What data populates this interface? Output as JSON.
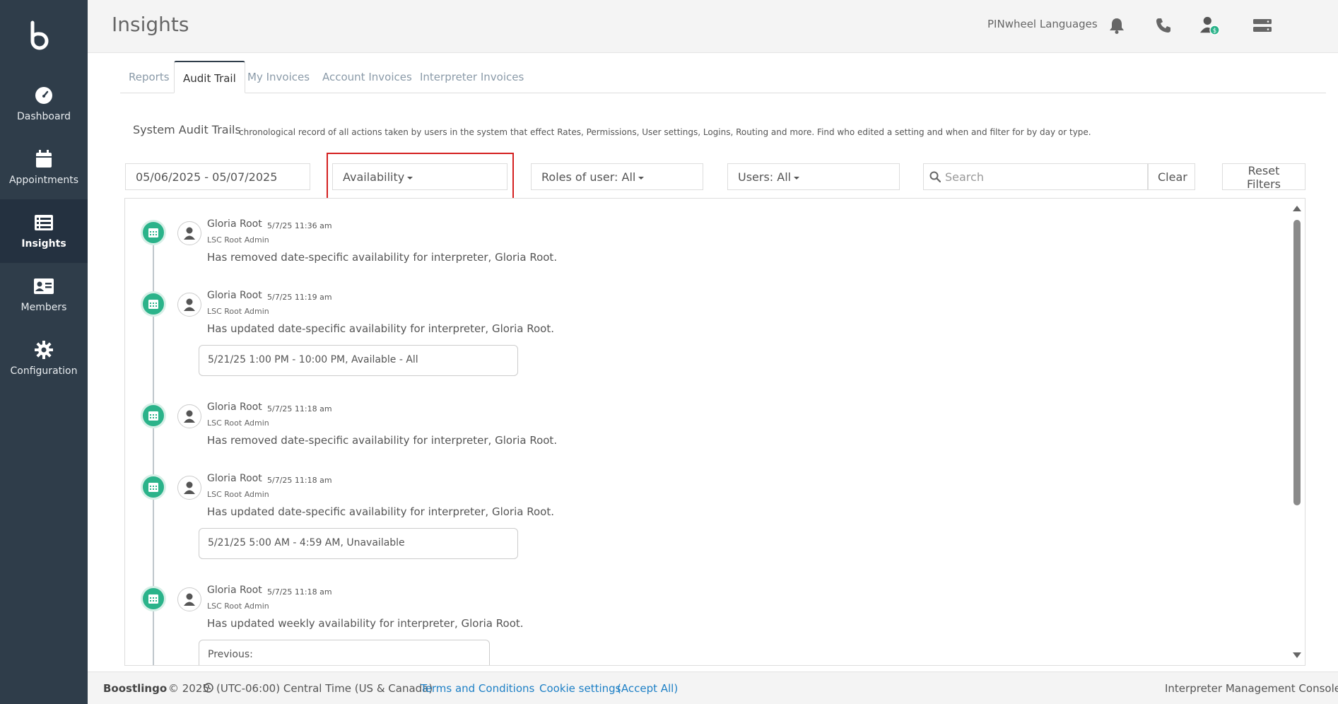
{
  "app": {
    "page_title": "Insights",
    "org_name": "PINwheel Languages"
  },
  "sidebar": {
    "items": [
      {
        "label": "Dashboard",
        "icon": "dashboard-icon"
      },
      {
        "label": "Appointments",
        "icon": "calendar-icon"
      },
      {
        "label": "Insights",
        "icon": "list-icon",
        "active": true
      },
      {
        "label": "Members",
        "icon": "id-card-icon"
      },
      {
        "label": "Configuration",
        "icon": "gear-icon"
      }
    ]
  },
  "header_icons": [
    "bell-icon",
    "phone-icon",
    "user-status-icon",
    "server-icon"
  ],
  "tabs": [
    {
      "label": "Reports"
    },
    {
      "label": "Audit Trail",
      "active": true
    },
    {
      "label": "My Invoices"
    },
    {
      "label": "Account Invoices"
    },
    {
      "label": "Interpreter Invoices"
    }
  ],
  "section": {
    "title": "System Audit Trails",
    "description": "chronological record of all actions taken by users in the system that effect Rates, Permissions, User settings, Logins, Routing and more. Find who edited a setting and when and filter for by day or type."
  },
  "filters": {
    "date_range": "05/06/2025 - 05/07/2025",
    "type": "Availability",
    "roles": "Roles of user: All",
    "users": "Users: All",
    "search_placeholder": "Search",
    "clear_label": "Clear",
    "reset_label": "Reset Filters"
  },
  "entries": [
    {
      "name": "Gloria Root",
      "time": "5/7/25 11:36 am",
      "role": "LSC Root Admin",
      "action": "Has removed date-specific availability for interpreter, Gloria Root.",
      "detail": ""
    },
    {
      "name": "Gloria Root",
      "time": "5/7/25 11:19 am",
      "role": "LSC Root Admin",
      "action": "Has updated date-specific availability for interpreter, Gloria Root.",
      "detail": "5/21/25 1:00 PM - 10:00 PM, Available - All"
    },
    {
      "name": "Gloria Root",
      "time": "5/7/25 11:18 am",
      "role": "LSC Root Admin",
      "action": "Has removed date-specific availability for interpreter, Gloria Root.",
      "detail": ""
    },
    {
      "name": "Gloria Root",
      "time": "5/7/25 11:18 am",
      "role": "LSC Root Admin",
      "action": "Has updated date-specific availability for interpreter, Gloria Root.",
      "detail": "5/21/25 5:00 AM - 4:59 AM, Unavailable"
    },
    {
      "name": "Gloria Root",
      "time": "5/7/25 11:18 am",
      "role": "LSC Root Admin",
      "action": "Has updated weekly availability for interpreter, Gloria Root.",
      "detail": "Previous:"
    }
  ],
  "footer": {
    "brand": "Boostlingo",
    "copyright": "© 2025",
    "timezone": "(UTC-06:00) Central Time (US & Canada)",
    "terms": "Terms and Conditions",
    "cookie": "Cookie settings",
    "accept": "(Accept All)",
    "console": "Interpreter Management Console"
  },
  "colors": {
    "sidebar_bg": "#2f3d4a",
    "accent_green": "#2bb38a",
    "highlight_red": "#d42020",
    "link_blue": "#1e80c6"
  }
}
